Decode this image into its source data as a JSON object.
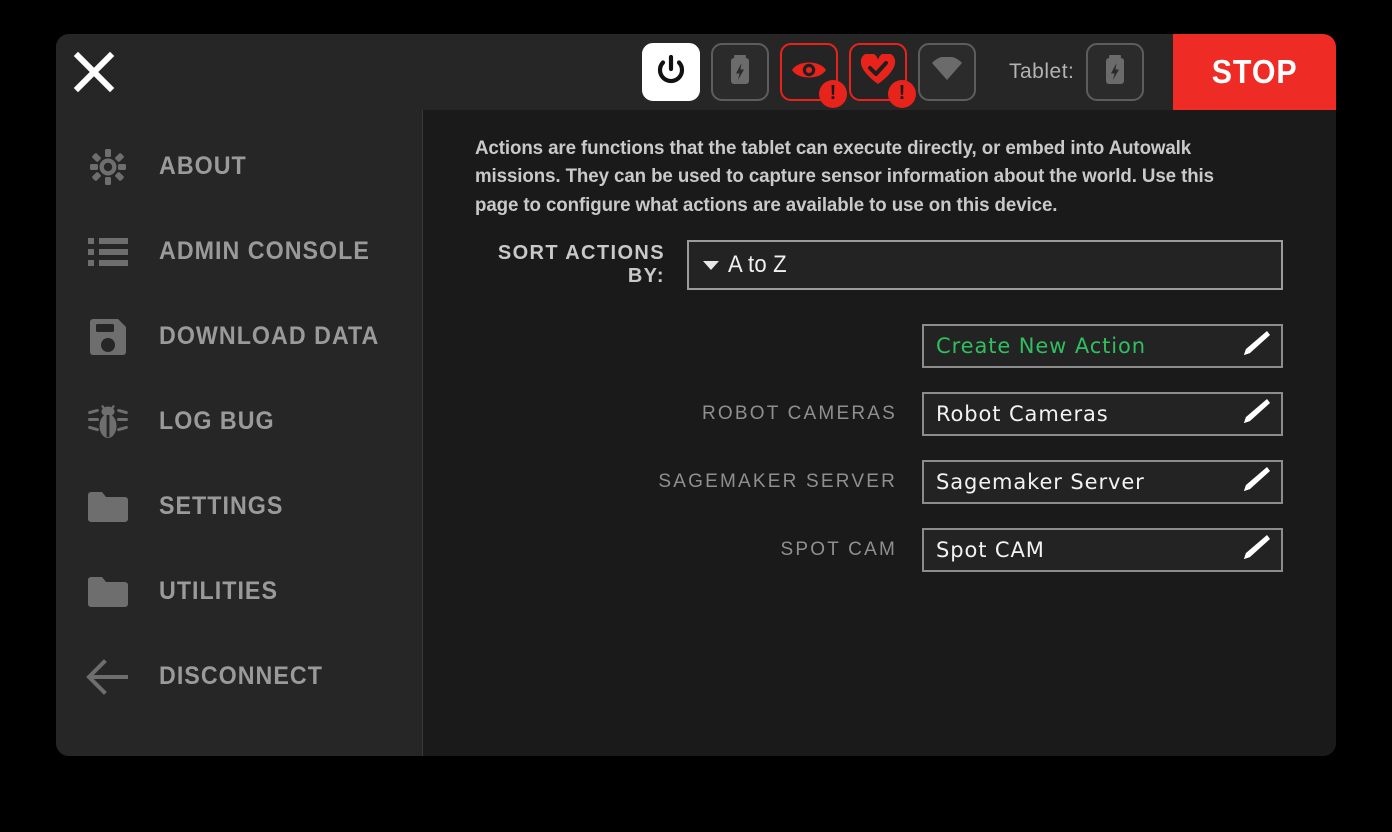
{
  "topbar": {
    "close_icon": "close-icon",
    "status_items": [
      {
        "icon": "power-icon",
        "style": "solid",
        "alert": false
      },
      {
        "icon": "battery-icon",
        "style": "outline",
        "alert": false
      },
      {
        "icon": "eye-icon",
        "style": "alert",
        "alert": true,
        "badge": "!"
      },
      {
        "icon": "heart-check-icon",
        "style": "alert",
        "alert": true,
        "badge": "!"
      },
      {
        "icon": "wifi-icon",
        "style": "outline",
        "alert": false
      }
    ],
    "tablet_label": "Tablet:",
    "tablet_icon": "battery-icon",
    "stop_label": "STOP",
    "stop_color": "#EE2B24"
  },
  "sidebar": {
    "items": [
      {
        "label": "ABOUT",
        "icon": "gear-icon"
      },
      {
        "label": "ADMIN CONSOLE",
        "icon": "list-icon"
      },
      {
        "label": "DOWNLOAD DATA",
        "icon": "save-disk-icon"
      },
      {
        "label": "LOG BUG",
        "icon": "bug-icon"
      },
      {
        "label": "SETTINGS",
        "icon": "folder-icon"
      },
      {
        "label": "UTILITIES",
        "icon": "folder-icon"
      },
      {
        "label": "DISCONNECT",
        "icon": "arrow-left-icon"
      }
    ]
  },
  "main": {
    "description": "Actions are functions that the tablet can execute directly, or embed into Autowalk missions. They can be used to capture sensor information about the world. Use this page to configure what actions are available to use on this device.",
    "sort": {
      "label": "SORT ACTIONS BY:",
      "value": "A to Z"
    },
    "actions": [
      {
        "label": "",
        "name": "Create New Action",
        "accent": "#2FBF5F",
        "edit_icon": "pencil-icon"
      },
      {
        "label": "ROBOT CAMERAS",
        "name": "Robot Cameras",
        "edit_icon": "pencil-icon"
      },
      {
        "label": "SAGEMAKER SERVER",
        "name": "Sagemaker Server",
        "edit_icon": "pencil-icon"
      },
      {
        "label": "SPOT CAM",
        "name": "Spot CAM",
        "edit_icon": "pencil-icon"
      }
    ]
  }
}
